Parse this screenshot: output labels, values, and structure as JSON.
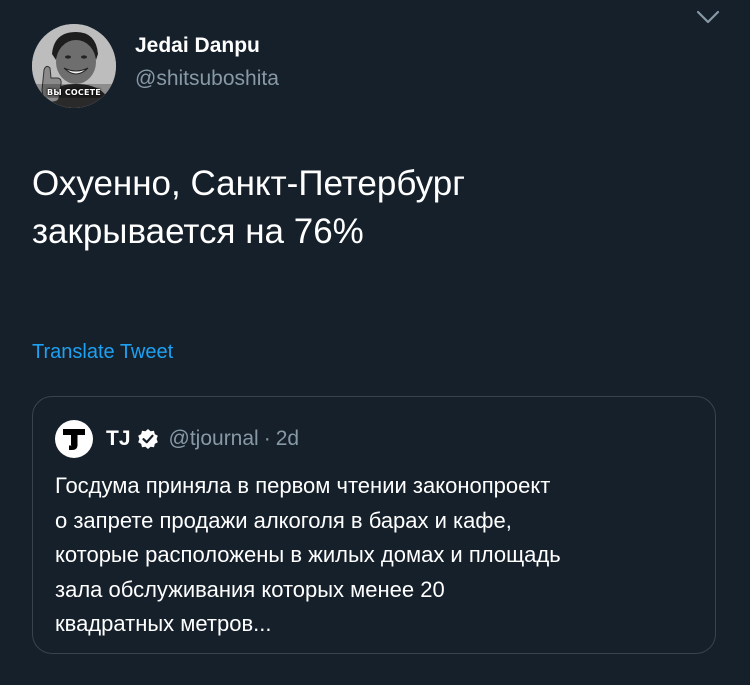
{
  "author": {
    "display_name": "Jedai Danpu",
    "handle": "@shitsuboshita",
    "avatar_caption": "ВЫ СОСЕТЕ"
  },
  "tweet": {
    "text_lines": [
      "Охуенно, Санкт-Петербург",
      "закрывается на 76%"
    ],
    "translate_label": "Translate Tweet"
  },
  "quoted_tweet": {
    "logo_letter": "T",
    "name": "TJ",
    "handle": "@tjournal",
    "separator": "·",
    "time": "2d",
    "text_lines": [
      "Госдума приняла в первом чтении законопроект",
      "о запрете продажи алкоголя в барах и кафе,",
      "которые расположены в жилых домах и площадь",
      "зала обслуживания которых менее 20",
      "квадратных метров..."
    ]
  },
  "icons": {
    "caret": "chevron-down-icon",
    "verified": "verified-badge-icon",
    "logo": "tj-logo-icon"
  },
  "colors": {
    "background": "#15202b",
    "text_primary": "#ffffff",
    "text_secondary": "#8899a6",
    "accent": "#1da1f2",
    "border": "#38444d"
  }
}
